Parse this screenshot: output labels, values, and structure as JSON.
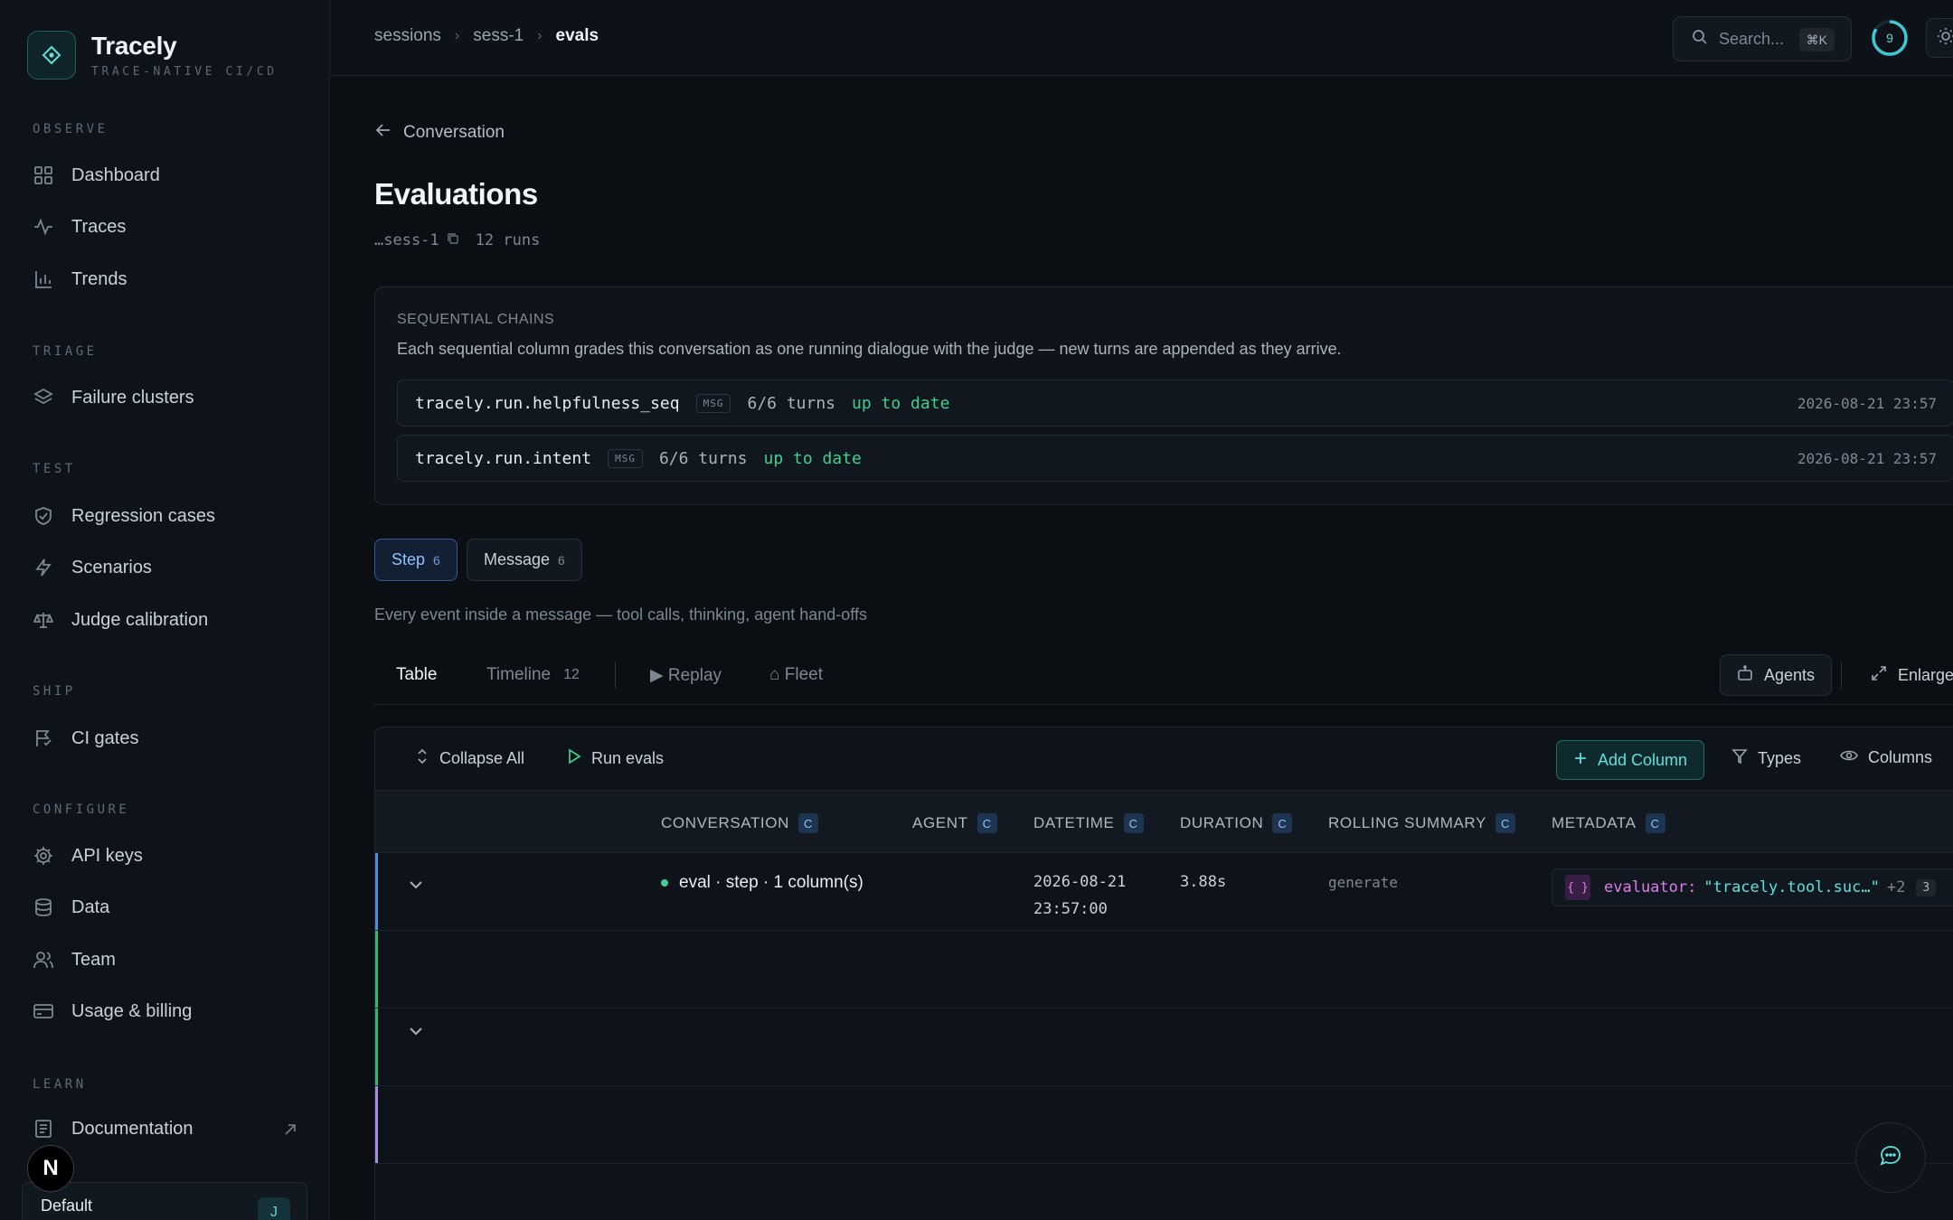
{
  "brand": {
    "name": "Tracely",
    "tagline": "TRACE-NATIVE CI/CD"
  },
  "sidebar": {
    "sections": [
      {
        "label": "OBSERVE",
        "items": [
          {
            "label": "Dashboard",
            "icon": "grid-icon"
          },
          {
            "label": "Traces",
            "icon": "activity-icon"
          },
          {
            "label": "Trends",
            "icon": "bar-chart-icon"
          }
        ]
      },
      {
        "label": "TRIAGE",
        "items": [
          {
            "label": "Failure clusters",
            "icon": "layers-icon"
          }
        ]
      },
      {
        "label": "TEST",
        "items": [
          {
            "label": "Regression cases",
            "icon": "shield-check-icon"
          },
          {
            "label": "Scenarios",
            "icon": "bolt-icon"
          },
          {
            "label": "Judge calibration",
            "icon": "scale-icon"
          }
        ]
      },
      {
        "label": "SHIP",
        "items": [
          {
            "label": "CI gates",
            "icon": "flag-icon"
          }
        ]
      },
      {
        "label": "CONFIGURE",
        "items": [
          {
            "label": "API keys",
            "icon": "gear-icon"
          },
          {
            "label": "Data",
            "icon": "database-icon"
          },
          {
            "label": "Team",
            "icon": "users-icon"
          },
          {
            "label": "Usage & billing",
            "icon": "credit-card-icon"
          }
        ]
      },
      {
        "label": "LEARN",
        "items": [
          {
            "label": "Documentation",
            "icon": "book-icon"
          }
        ]
      }
    ],
    "workspace": {
      "name": "Default",
      "avatar": "J"
    },
    "n_badge": "N"
  },
  "topbar": {
    "breadcrumbs": [
      "sessions",
      "sess-1",
      "evals"
    ],
    "search_placeholder": "Search...",
    "search_shortcut": "⌘K",
    "progress_count": "9"
  },
  "page": {
    "back_label": "Conversation",
    "title": "Evaluations",
    "session_id": "…sess-1",
    "runs": "12 runs"
  },
  "chains": {
    "heading": "SEQUENTIAL CHAINS",
    "description": "Each sequential column grades this conversation as one running dialogue with the judge — new turns are appended as they arrive.",
    "rows": [
      {
        "name": "tracely.run.helpfulness_seq",
        "tag": "MSG",
        "turns": "6/6 turns",
        "status": "up to date",
        "time": "2026-08-21 23:57"
      },
      {
        "name": "tracely.run.intent",
        "tag": "MSG",
        "turns": "6/6 turns",
        "status": "up to date",
        "time": "2026-08-21 23:57"
      }
    ]
  },
  "segments": [
    {
      "label": "Step",
      "count": "6",
      "active": true
    },
    {
      "label": "Message",
      "count": "6",
      "active": false
    }
  ],
  "hint": "Every event inside a message — tool calls, thinking, agent hand-offs",
  "view_tabs": {
    "table": "Table",
    "timeline": "Timeline",
    "timeline_count": "12",
    "replay": "▶ Replay",
    "fleet": "⌂ Fleet",
    "agents": "Agents",
    "enlarge": "Enlarge"
  },
  "toolbar": {
    "collapse_all": "Collapse All",
    "run_evals": "Run evals",
    "add_column": "Add Column",
    "types": "Types",
    "columns": "Columns"
  },
  "table": {
    "columns": [
      {
        "label": "CONVERSATION",
        "badge": "C"
      },
      {
        "label": "AGENT",
        "badge": "C"
      },
      {
        "label": "DATETIME",
        "badge": "C"
      },
      {
        "label": "DURATION",
        "badge": "C"
      },
      {
        "label": "ROLLING SUMMARY",
        "badge": "C"
      },
      {
        "label": "METADATA",
        "badge": "C"
      }
    ],
    "rows": [
      {
        "conversation": "eval · step · 1 column(s)",
        "date": "2026-08-21",
        "time": "23:57:00",
        "duration": "3.88s",
        "summary": "generate",
        "meta_brace": "{ }",
        "meta_key": "evaluator:",
        "meta_value": "\"tracely.tool.suc…\"",
        "meta_more": "+2",
        "meta_count": "3"
      }
    ]
  },
  "colors": {
    "accent": "#5fe0dc",
    "success": "#3fcf8e",
    "active_blue": "#8fc1ff",
    "row_bar_blue": "#4f8ce0",
    "row_bar_green": "#2fb870",
    "row_bar_purple": "#a98be0"
  }
}
